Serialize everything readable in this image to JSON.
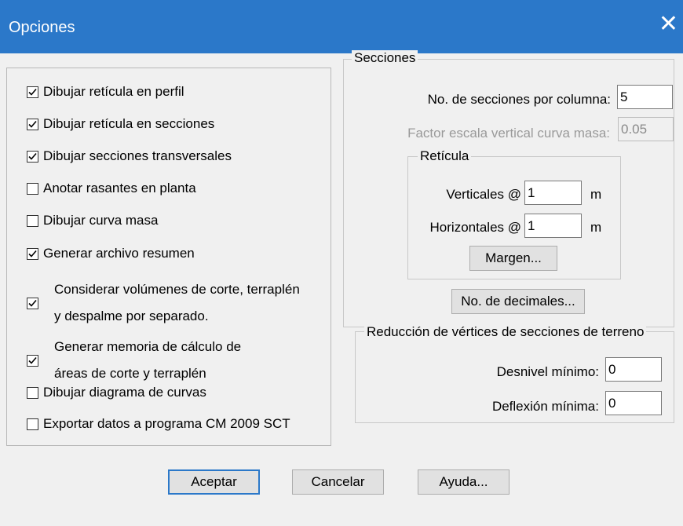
{
  "window": {
    "title": "Opciones",
    "close_glyph": "✕"
  },
  "options": [
    {
      "lines": [
        "Dibujar retícula en perfil"
      ],
      "checked": true
    },
    {
      "lines": [
        "Dibujar retícula en secciones"
      ],
      "checked": true
    },
    {
      "lines": [
        "Dibujar secciones transversales"
      ],
      "checked": true
    },
    {
      "lines": [
        "Anotar rasantes en planta"
      ],
      "checked": false
    },
    {
      "lines": [
        "Dibujar curva masa"
      ],
      "checked": false
    },
    {
      "lines": [
        "Generar archivo resumen"
      ],
      "checked": true
    },
    {
      "lines": [
        "Considerar volúmenes de corte, terraplén",
        "y despalme por separado."
      ],
      "checked": true
    },
    {
      "lines": [
        "Generar memoria de cálculo de",
        "áreas de corte y terraplén"
      ],
      "checked": true
    },
    {
      "lines": [
        "Dibujar diagrama de curvas"
      ],
      "checked": false
    },
    {
      "lines": [
        "Exportar datos a programa CM 2009 SCT"
      ],
      "checked": false
    }
  ],
  "secciones": {
    "title": "Secciones",
    "per_column_label": "No. de secciones por columna:",
    "per_column_value": "5",
    "factor_label": "Factor escala vertical curva masa:",
    "factor_value": "0.05",
    "reticula": {
      "title": "Retícula",
      "verticales_label": "Verticales @",
      "verticales_value": "1",
      "horizontales_label": "Horizontales @",
      "horizontales_value": "1",
      "unit": "m",
      "margen_button": "Margen..."
    },
    "decimales_button": "No. de decimales..."
  },
  "reduccion": {
    "title": "Reducción de vértices de secciones de terreno",
    "desnivel_label": "Desnivel mínimo:",
    "desnivel_value": "0",
    "deflexion_label": "Deflexión mínima:",
    "deflexion_value": "0"
  },
  "buttons": {
    "accept": "Aceptar",
    "cancel": "Cancelar",
    "help": "Ayuda..."
  },
  "colors": {
    "titlebar": "#2b78c9",
    "dialog_bg": "#f0f0f0"
  }
}
